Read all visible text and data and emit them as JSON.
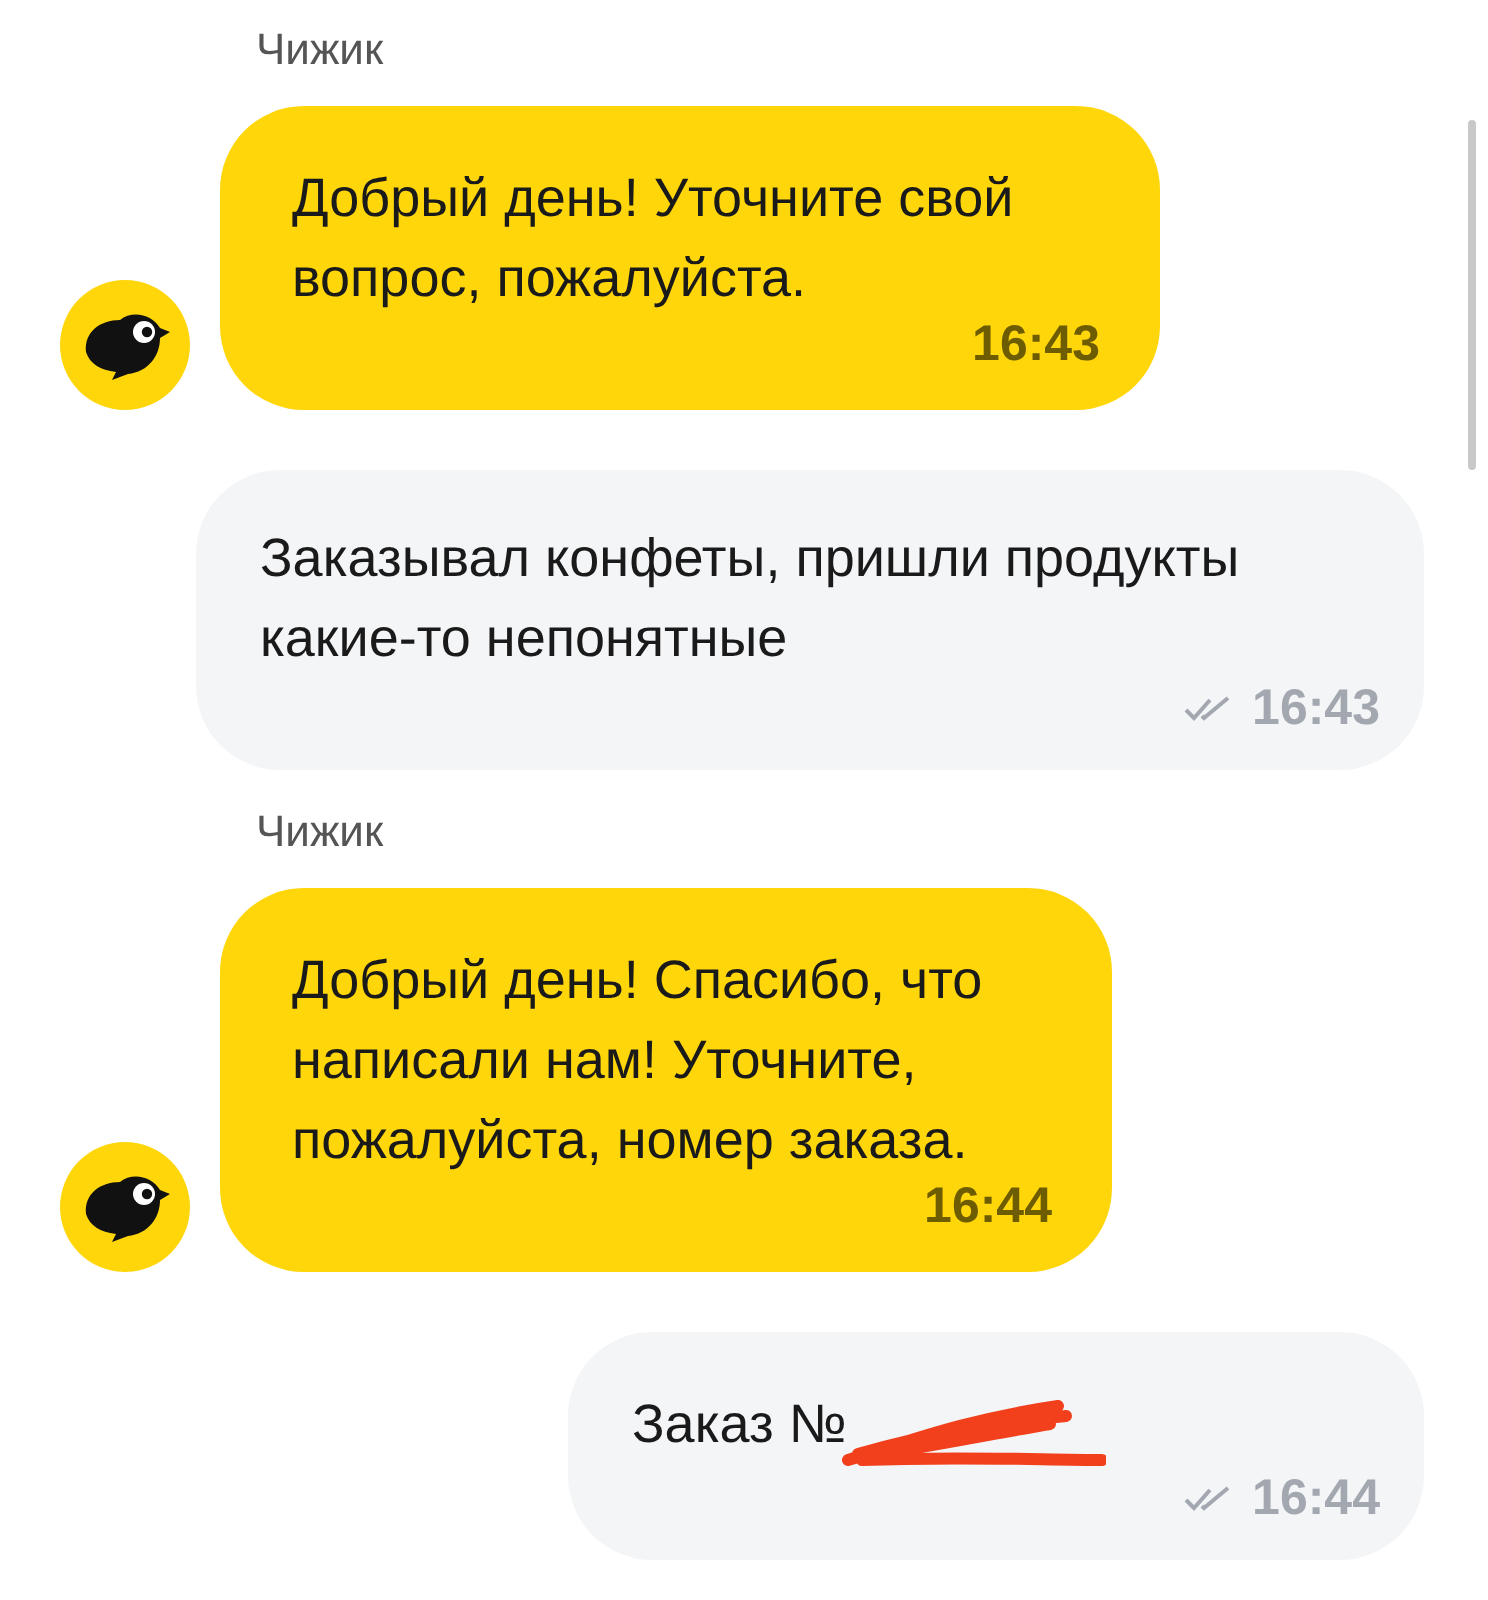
{
  "messages": [
    {
      "kind": "bot",
      "sender": "Чижик",
      "text": "Добрый день! Уточните свой вопрос, пожалуйста.",
      "time": "16:43"
    },
    {
      "kind": "user",
      "text": "Заказывал конфеты, пришли продукты какие-то непонятные",
      "time": "16:43",
      "read": true,
      "redacted": false
    },
    {
      "kind": "bot",
      "sender": "Чижик",
      "text": "Добрый день! Спасибо, что написали нам! Уточните, пожалуйста, номер заказа.",
      "time": "16:44"
    },
    {
      "kind": "user",
      "text": "Заказ №",
      "time": "16:44",
      "read": true,
      "redacted": true
    }
  ]
}
